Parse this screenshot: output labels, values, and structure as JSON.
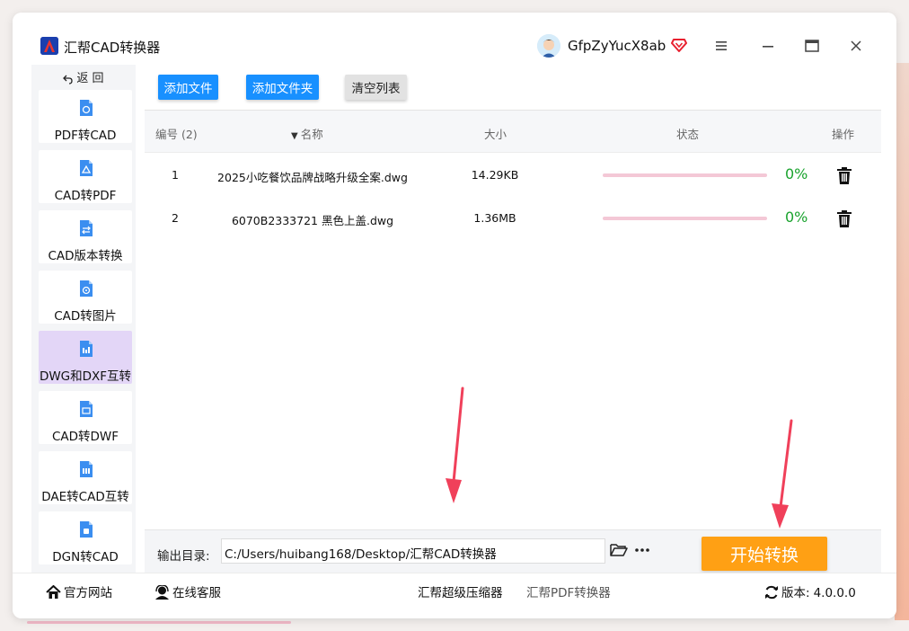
{
  "app": {
    "title": "汇帮CAD转换器",
    "user_name": "GfpZyYucX8ab"
  },
  "sidebar": {
    "back_label": "返 回",
    "items": [
      {
        "label": "PDF转CAD",
        "icon": "pdf-to-cad-icon"
      },
      {
        "label": "CAD转PDF",
        "icon": "cad-to-pdf-icon"
      },
      {
        "label": "CAD版本转换",
        "icon": "cad-version-icon"
      },
      {
        "label": "CAD转图片",
        "icon": "cad-to-image-icon"
      },
      {
        "label": "DWG和DXF互转",
        "icon": "dwg-dxf-icon",
        "active": true
      },
      {
        "label": "CAD转DWF",
        "icon": "cad-to-dwf-icon"
      },
      {
        "label": "DAE转CAD互转",
        "icon": "dae-to-cad-icon"
      },
      {
        "label": "DGN转CAD",
        "icon": "dgn-to-cad-icon"
      }
    ]
  },
  "toolbar": {
    "add_file_label": "添加文件",
    "add_folder_label": "添加文件夹",
    "clear_label": "清空列表"
  },
  "table": {
    "headers": {
      "number": "编号 (2)",
      "name": "名称",
      "size": "大小",
      "status": "状态",
      "action": "操作"
    },
    "rows": [
      {
        "number": "1",
        "name": "2025小吃餐饮品牌战略升级全案.dwg",
        "size": "14.29KB",
        "progress": 0,
        "progress_label": "0%"
      },
      {
        "number": "2",
        "name": "6070B2333721 黑色上盖.dwg",
        "size": "1.36MB",
        "progress": 0,
        "progress_label": "0%"
      }
    ]
  },
  "output": {
    "label": "输出目录:",
    "path": "C:/Users/huibang168/Desktop/汇帮CAD转换器",
    "start_label": "开始转换"
  },
  "footer": {
    "official_site": "官方网站",
    "online_service": "在线客服",
    "compressor": "汇帮超级压缩器",
    "pdf_converter": "汇帮PDF转换器",
    "version_label": "版本:",
    "version": "4.0.0.0"
  },
  "colors": {
    "primary_button": "#1890ff",
    "start_button": "#ffa014",
    "active_nav": "#e3d6f7",
    "progress_track": "#f4c8d6",
    "percent_text": "#1aa32e",
    "annotation_arrow": "#f0405a"
  }
}
